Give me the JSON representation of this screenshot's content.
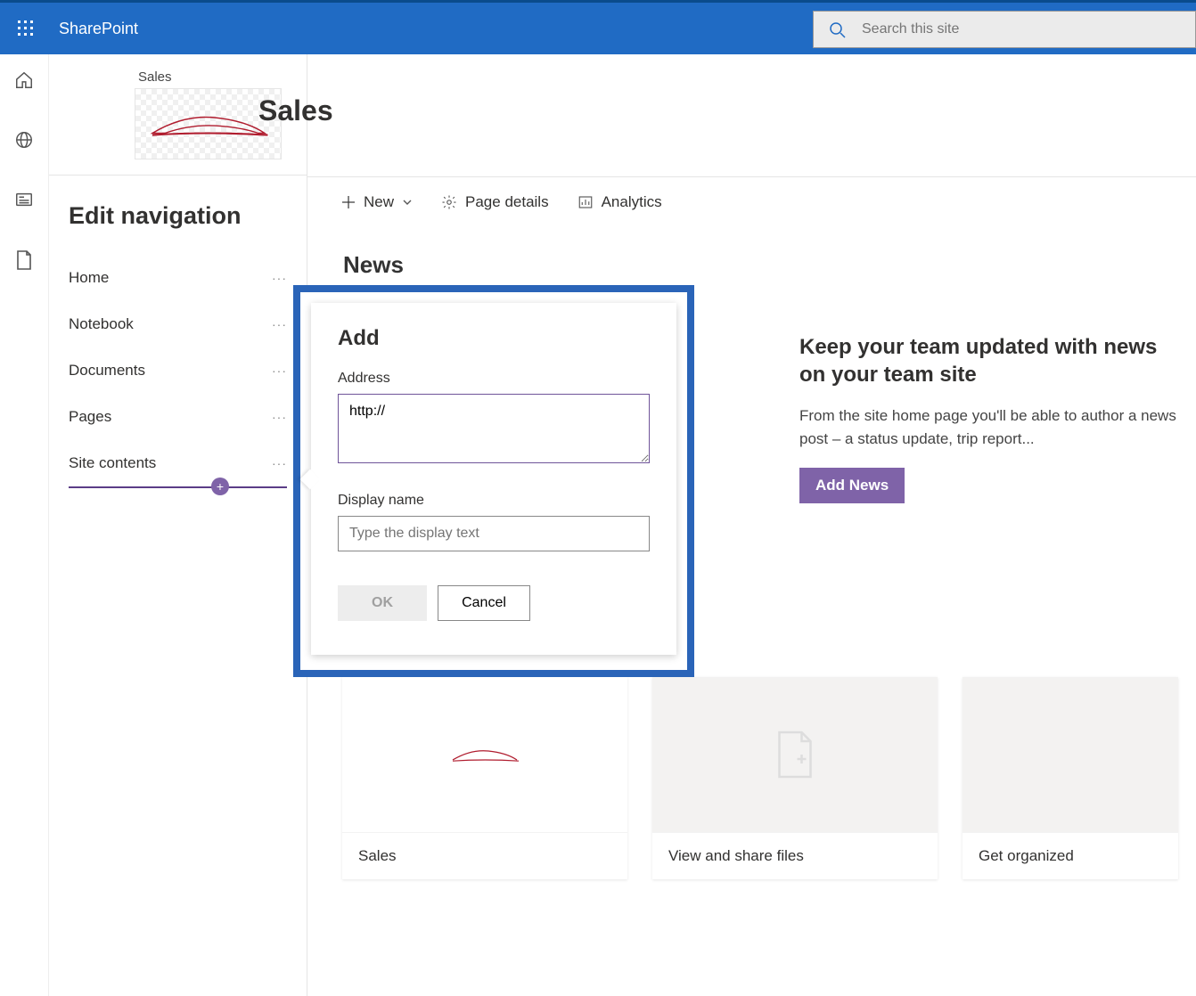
{
  "suite": {
    "brand": "SharePoint",
    "search_placeholder": "Search this site"
  },
  "rail": {
    "items": [
      "home",
      "globe",
      "news",
      "file"
    ]
  },
  "site": {
    "breadcrumb": "Sales",
    "title": "Sales"
  },
  "nav_panel": {
    "heading": "Edit navigation",
    "items": [
      {
        "label": "Home"
      },
      {
        "label": "Notebook"
      },
      {
        "label": "Documents"
      },
      {
        "label": "Pages"
      },
      {
        "label": "Site contents"
      }
    ],
    "more": "···"
  },
  "commands": {
    "new": "New",
    "page_details": "Page details",
    "analytics": "Analytics"
  },
  "news": {
    "heading": "News",
    "promo_title": "Keep your team updated with news on your team site",
    "promo_body": "From the site home page you'll be able to author a news post – a status update, trip report...",
    "add_button": "Add News"
  },
  "cards": [
    {
      "title": "Sales"
    },
    {
      "title": "View and share files"
    },
    {
      "title": "Get organized"
    }
  ],
  "dialog": {
    "title": "Add",
    "address_label": "Address",
    "address_value": "http://",
    "display_label": "Display name",
    "display_placeholder": "Type the display text",
    "ok": "OK",
    "cancel": "Cancel"
  }
}
